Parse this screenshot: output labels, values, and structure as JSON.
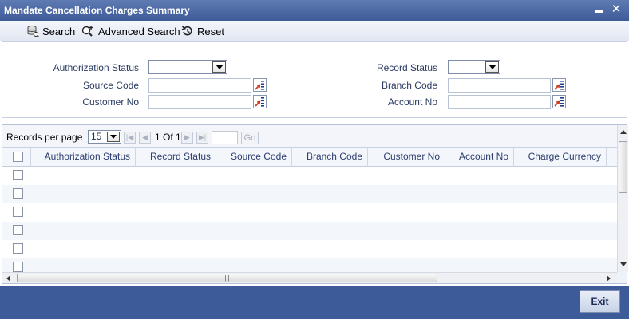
{
  "window": {
    "title": "Mandate Cancellation Charges Summary"
  },
  "toolbar": {
    "search_label": "Search",
    "advanced_search_label": "Advanced Search",
    "reset_label": "Reset"
  },
  "search_form": {
    "authorization_status_label": "Authorization Status",
    "record_status_label": "Record Status",
    "source_code_label": "Source Code",
    "branch_code_label": "Branch Code",
    "customer_no_label": "Customer No",
    "account_no_label": "Account No",
    "authorization_status_value": "",
    "record_status_value": "",
    "source_code_value": "",
    "branch_code_value": "",
    "customer_no_value": "",
    "account_no_value": ""
  },
  "pager": {
    "records_per_page_label": "Records per page",
    "records_per_page_value": "15",
    "page_indicator": "1 Of 1",
    "go_label": "Go"
  },
  "grid": {
    "columns": [
      "Authorization Status",
      "Record Status",
      "Source Code",
      "Branch Code",
      "Customer No",
      "Account No",
      "Charge Currency"
    ],
    "row_count": 6
  },
  "footer": {
    "exit_label": "Exit"
  },
  "colors": {
    "title_bar": "#3e5b99",
    "footer_bar": "#3e5b99",
    "header_text": "#2d3d6e"
  }
}
